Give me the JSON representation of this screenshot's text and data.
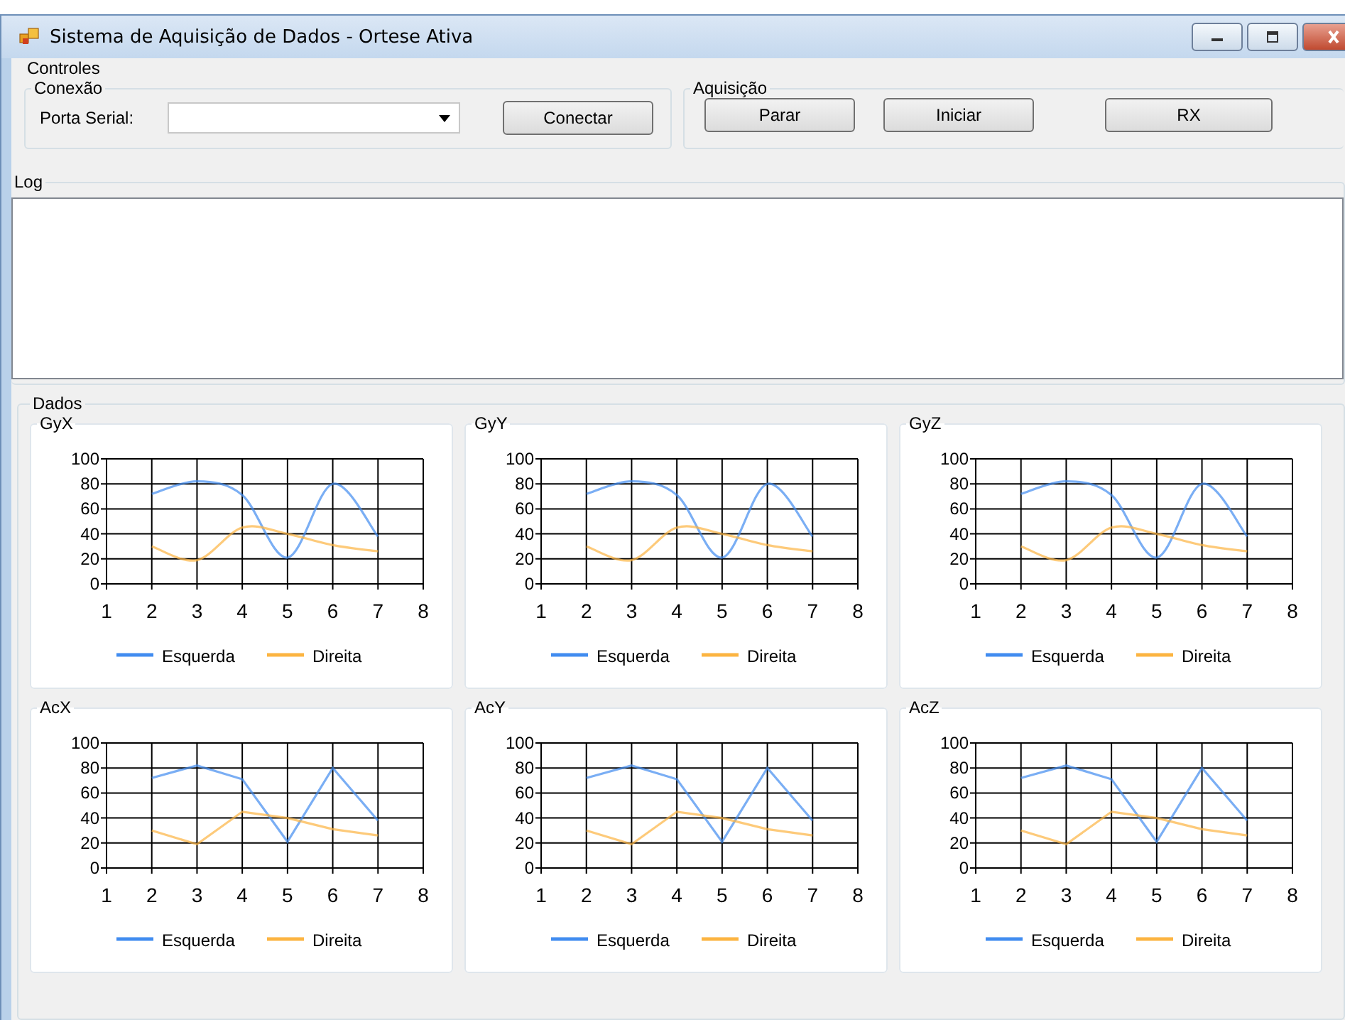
{
  "window": {
    "title": "Sistema de Aquisição de Dados - Ortese Ativa"
  },
  "controls": {
    "title": "Controles",
    "connection": {
      "title": "Conexão",
      "port_label": "Porta Serial:",
      "connect_button": "Conectar"
    },
    "acquisition": {
      "title": "Aquisição",
      "buttons": [
        "Parar",
        "Iniciar",
        "RX"
      ]
    }
  },
  "log": {
    "title": "Log"
  },
  "data": {
    "title": "Dados",
    "panels": [
      {
        "kind": "smooth",
        "chart_data": {
          "type": "line",
          "title": "GyX",
          "grid": true,
          "legend": "bottom",
          "x": [
            2,
            3,
            4,
            5,
            6,
            7
          ],
          "xlim": [
            1,
            8
          ],
          "ylim": [
            0,
            100
          ],
          "xticks": [
            1,
            2,
            3,
            4,
            5,
            6,
            7,
            8
          ],
          "yticks": [
            0,
            20,
            40,
            60,
            80,
            100
          ],
          "series": [
            {
              "name": "Esquerda",
              "color": "#418cf0",
              "values": [
                72,
                82,
                71,
                21,
                80,
                38
              ]
            },
            {
              "name": "Direita",
              "color": "#fcb441",
              "values": [
                30,
                19,
                45,
                40,
                31,
                26
              ]
            }
          ]
        }
      },
      {
        "kind": "smooth",
        "chart_data": {
          "type": "line",
          "title": "GyY",
          "grid": true,
          "legend": "bottom",
          "x": [
            2,
            3,
            4,
            5,
            6,
            7
          ],
          "xlim": [
            1,
            8
          ],
          "ylim": [
            0,
            100
          ],
          "xticks": [
            1,
            2,
            3,
            4,
            5,
            6,
            7,
            8
          ],
          "yticks": [
            0,
            20,
            40,
            60,
            80,
            100
          ],
          "series": [
            {
              "name": "Esquerda",
              "color": "#418cf0",
              "values": [
                72,
                82,
                71,
                21,
                80,
                38
              ]
            },
            {
              "name": "Direita",
              "color": "#fcb441",
              "values": [
                30,
                19,
                45,
                40,
                31,
                26
              ]
            }
          ]
        }
      },
      {
        "kind": "smooth",
        "chart_data": {
          "type": "line",
          "title": "GyZ",
          "grid": true,
          "legend": "bottom",
          "x": [
            2,
            3,
            4,
            5,
            6,
            7
          ],
          "xlim": [
            1,
            8
          ],
          "ylim": [
            0,
            100
          ],
          "xticks": [
            1,
            2,
            3,
            4,
            5,
            6,
            7,
            8
          ],
          "yticks": [
            0,
            20,
            40,
            60,
            80,
            100
          ],
          "series": [
            {
              "name": "Esquerda",
              "color": "#418cf0",
              "values": [
                72,
                82,
                71,
                21,
                80,
                38
              ]
            },
            {
              "name": "Direita",
              "color": "#fcb441",
              "values": [
                30,
                19,
                45,
                40,
                31,
                26
              ]
            }
          ]
        }
      },
      {
        "kind": "straight",
        "chart_data": {
          "type": "line",
          "title": "AcX",
          "grid": true,
          "legend": "bottom",
          "x": [
            2,
            3,
            4,
            5,
            6,
            7
          ],
          "xlim": [
            1,
            8
          ],
          "ylim": [
            0,
            100
          ],
          "xticks": [
            1,
            2,
            3,
            4,
            5,
            6,
            7,
            8
          ],
          "yticks": [
            0,
            20,
            40,
            60,
            80,
            100
          ],
          "series": [
            {
              "name": "Esquerda",
              "color": "#418cf0",
              "values": [
                72,
                82,
                71,
                21,
                80,
                38
              ]
            },
            {
              "name": "Direita",
              "color": "#fcb441",
              "values": [
                30,
                19,
                45,
                40,
                31,
                26
              ]
            }
          ]
        }
      },
      {
        "kind": "straight",
        "chart_data": {
          "type": "line",
          "title": "AcY",
          "grid": true,
          "legend": "bottom",
          "x": [
            2,
            3,
            4,
            5,
            6,
            7
          ],
          "xlim": [
            1,
            8
          ],
          "ylim": [
            0,
            100
          ],
          "xticks": [
            1,
            2,
            3,
            4,
            5,
            6,
            7,
            8
          ],
          "yticks": [
            0,
            20,
            40,
            60,
            80,
            100
          ],
          "series": [
            {
              "name": "Esquerda",
              "color": "#418cf0",
              "values": [
                72,
                82,
                71,
                21,
                80,
                38
              ]
            },
            {
              "name": "Direita",
              "color": "#fcb441",
              "values": [
                30,
                19,
                45,
                40,
                31,
                26
              ]
            }
          ]
        }
      },
      {
        "kind": "straight",
        "chart_data": {
          "type": "line",
          "title": "AcZ",
          "grid": true,
          "legend": "bottom",
          "x": [
            2,
            3,
            4,
            5,
            6,
            7
          ],
          "xlim": [
            1,
            8
          ],
          "ylim": [
            0,
            100
          ],
          "xticks": [
            1,
            2,
            3,
            4,
            5,
            6,
            7,
            8
          ],
          "yticks": [
            0,
            20,
            40,
            60,
            80,
            100
          ],
          "series": [
            {
              "name": "Esquerda",
              "color": "#418cf0",
              "values": [
                72,
                82,
                71,
                21,
                80,
                38
              ]
            },
            {
              "name": "Direita",
              "color": "#fcb441",
              "values": [
                30,
                19,
                45,
                40,
                31,
                26
              ]
            }
          ]
        }
      }
    ]
  }
}
